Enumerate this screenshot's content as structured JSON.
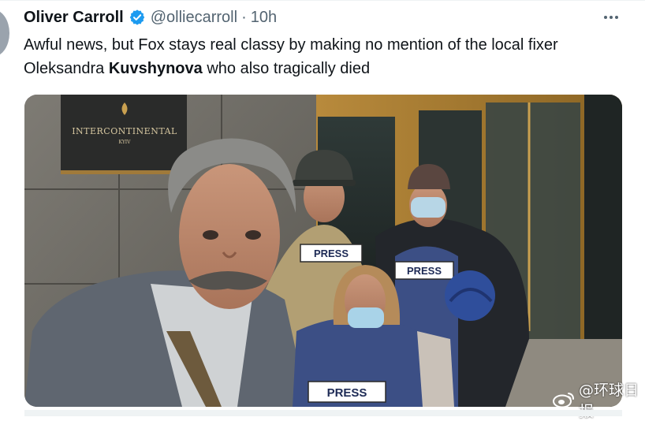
{
  "tweet": {
    "author_name": "Oliver Carroll",
    "verified_icon": "verified-badge-icon",
    "handle": "@olliecarroll",
    "separator": "·",
    "time": "10h",
    "more_icon": "more-options-icon",
    "text_part1": "Awful news, but Fox stays real classy by making no mention of the local fixer Oleksandra ",
    "text_bold": "Kuvshynova",
    "text_part2": " who also tragically died"
  },
  "media": {
    "sign_line1": "INTERCONTINENTAL",
    "sign_line2": "KYIV",
    "vest_labels": [
      "PRESS",
      "PRESS",
      "PRESS"
    ]
  },
  "watermark": {
    "logo_icon": "weibo-logo-icon",
    "text": "@环球日报"
  },
  "colors": {
    "verified_blue": "#1d9bf0",
    "text_primary": "#0f1419",
    "text_secondary": "#536471",
    "vest_blue": "#3c4f85",
    "vest_tan": "#b8a57a"
  }
}
